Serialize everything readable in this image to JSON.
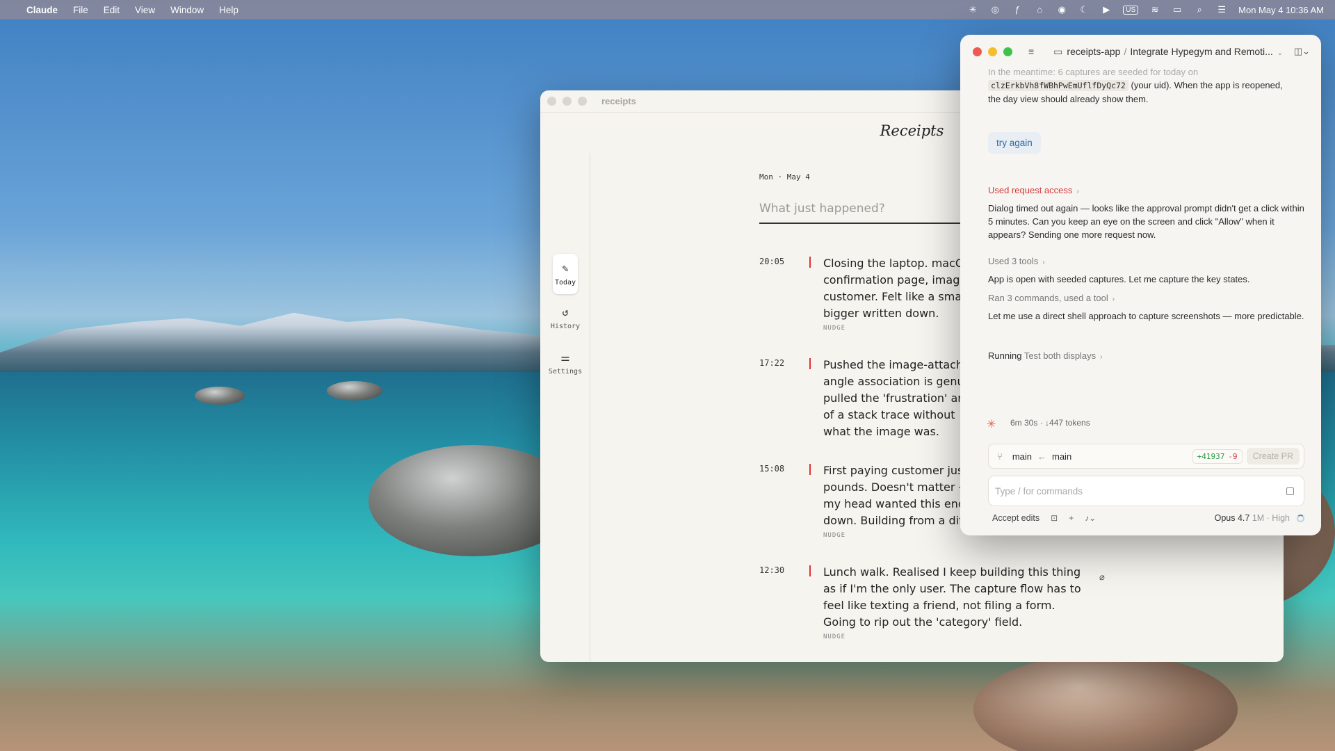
{
  "menubar": {
    "app": "Claude",
    "items": [
      "File",
      "Edit",
      "View",
      "Window",
      "Help"
    ],
    "input_source": "US",
    "datetime": "Mon May 4  10:36 AM"
  },
  "receipts": {
    "window_title": "receipts",
    "heading": "Receipts",
    "nav": [
      {
        "label": "Today",
        "icon": "edit-list-icon"
      },
      {
        "label": "History",
        "icon": "history-icon"
      },
      {
        "label": "Settings",
        "icon": "sliders-icon"
      }
    ],
    "date": "Mon · May 4",
    "input_placeholder": "What just happened?",
    "entries": [
      {
        "time": "20:05",
        "text": "Closing the laptop. macO\nconfirmation page, image\ncustomer. Felt like a sma\nbigger written down.",
        "tag": "NUDGE"
      },
      {
        "time": "17:22",
        "text": "Pushed the image-attach\nangle association is genu\npulled the 'frustration' ar\nof a stack trace without\nwhat the image was.",
        "tag": ""
      },
      {
        "time": "15:08",
        "text": "First paying customer jus\npounds. Doesn't matter –\nmy head wanted this enc\ndown. Building from a dif",
        "tag": "NUDGE"
      },
      {
        "time": "12:30",
        "text": "Lunch walk. Realised I keep building this thing\nas if I'm the only user. The capture flow has to\nfeel like texting a friend, not filing a form.\nGoing to rip out the 'category' field.",
        "tag": "NUDGE"
      }
    ]
  },
  "claude": {
    "breadcrumb_project": "receipts-app",
    "breadcrumb_task": "Integrate Hypegym and Remoti...",
    "top_text_faded": "In the meantime: 6 captures are seeded for today on",
    "uid_code": "clzErkbVh8fWBhPwEmUflfDyQc72",
    "uid_text": " (your uid). When the app is reopened,",
    "uid_text2": "the day view should already show them.",
    "try_again": "try again",
    "used_request_access": "Used request access",
    "dialog_text": "Dialog timed out again — looks like the approval prompt didn't get a click within 5 minutes. Can you keep an eye on the screen and click \"Allow\" when it appears? Sending one more request now.",
    "used_tools": "Used 3 tools",
    "app_open_text": "App is open with seeded captures. Let me capture the key states.",
    "ran_commands": "Ran 3 commands, used a tool",
    "shell_text": "Let me use a direct shell approach to capture screenshots — more predictable.",
    "running_label": "Running",
    "running_task": "Test both displays",
    "stats": "6m 30s · ↓447 tokens",
    "branch_from": "main",
    "branch_to": "main",
    "diff_add": "+41937",
    "diff_del": "-9",
    "create_pr": "Create PR",
    "command_placeholder": "Type / for commands",
    "accept_edits": "Accept edits",
    "model": "Opus 4.7",
    "model_ctx": "1M · High"
  }
}
